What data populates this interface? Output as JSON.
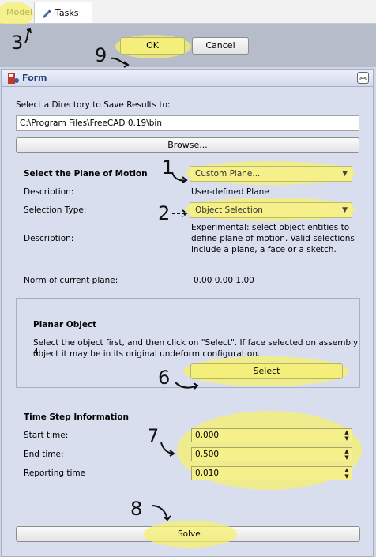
{
  "tabs": {
    "model": "Model",
    "tasks": "Tasks"
  },
  "buttons": {
    "ok": "OK",
    "cancel": "Cancel"
  },
  "panel": {
    "title": "Form",
    "directory_label": "Select a Directory to Save Results to:",
    "directory_value": "C:\\Program Files\\FreeCAD 0.19\\bin",
    "browse": "Browse...",
    "plane_heading": "Select the Plane of Motion",
    "plane_combo": "Custom Plane...",
    "description_label": "Description:",
    "description_value": "User-defined Plane",
    "selection_type_label": "Selection Type:",
    "selection_type_combo": "Object Selection",
    "description2_label": "Description:",
    "description2_value_1": "Experimental: select object entities to",
    "description2_value_2": "define plane of motion. Valid selections",
    "description2_value_3": "include a plane, a face or a sketch.",
    "norm_label": "Norm of current plane:",
    "norm_value": "0.00 0.00 1.00",
    "planar_heading": "Planar Object",
    "planar_text_1": "Select the object first, and then click on \"Select\". If face selected on assembly 4",
    "planar_text_2": "object it may be in its original undeform configuration.",
    "select_button": "Select",
    "timestep_heading": "Time Step Information",
    "start_label": "Start time:",
    "start_value": "0,000",
    "end_label": "End time:",
    "end_value": "0,500",
    "report_label": "Reporting time",
    "report_value": "0,010",
    "solve_button": "Solve"
  },
  "annotations": {
    "a1": "1",
    "a2": "2",
    "a3": "3",
    "a6": "6",
    "a7": "7",
    "a8": "8",
    "a9": "9"
  },
  "colors": {
    "highlight": "#f5f06e",
    "panel_bg": "#d9deef",
    "top_bg": "#b7bccb"
  },
  "icons": {
    "tasks": "pencil-icon",
    "form": "freecad-icon",
    "collapse": "chevron-up-icon"
  }
}
